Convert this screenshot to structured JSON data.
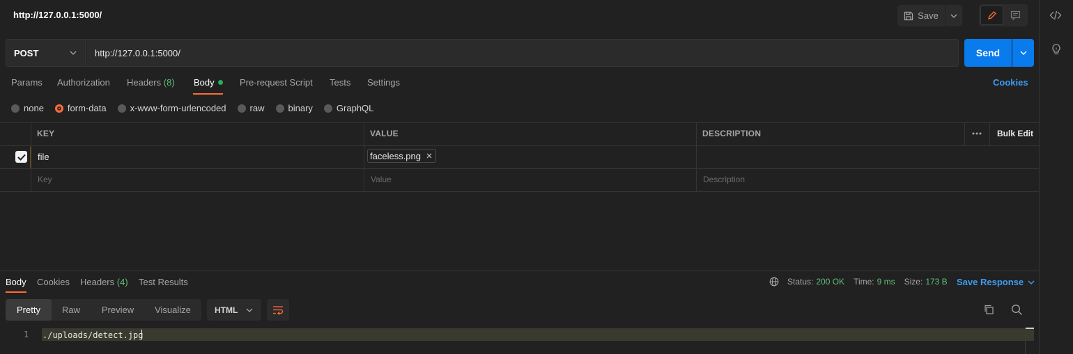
{
  "header": {
    "title": "http://127.0.0.1:5000/",
    "save_label": "Save"
  },
  "request": {
    "method": "POST",
    "url": "http://127.0.0.1:5000/",
    "send_label": "Send",
    "tabs": [
      {
        "label": "Params"
      },
      {
        "label": "Authorization"
      },
      {
        "label": "Headers",
        "count": "(8)"
      },
      {
        "label": "Body"
      },
      {
        "label": "Pre-request Script"
      },
      {
        "label": "Tests"
      },
      {
        "label": "Settings"
      }
    ],
    "cookies_label": "Cookies",
    "body_types": [
      "none",
      "form-data",
      "x-www-form-urlencoded",
      "raw",
      "binary",
      "GraphQL"
    ],
    "selected_body_type": "form-data"
  },
  "params_table": {
    "headers": {
      "key": "KEY",
      "value": "VALUE",
      "description": "DESCRIPTION",
      "bulk_edit": "Bulk Edit"
    },
    "rows": [
      {
        "key": "file",
        "value": "faceless.png",
        "checked": true
      }
    ],
    "placeholders": {
      "key": "Key",
      "value": "Value",
      "description": "Description"
    }
  },
  "response": {
    "tabs": [
      {
        "label": "Body"
      },
      {
        "label": "Cookies"
      },
      {
        "label": "Headers",
        "count": "(4)"
      },
      {
        "label": "Test Results"
      }
    ],
    "status_label": "Status:",
    "status_value": "200 OK",
    "time_label": "Time:",
    "time_value": "9 ms",
    "size_label": "Size:",
    "size_value": "173 B",
    "save_response_label": "Save Response",
    "views": [
      "Pretty",
      "Raw",
      "Preview",
      "Visualize"
    ],
    "format": "HTML",
    "lines": [
      {
        "num": "1",
        "text": "./uploads/detect.jpg"
      }
    ]
  },
  "colors": {
    "accent": "#ff6c37",
    "send": "#097bed",
    "link": "#3d9cf4",
    "success": "#5fbf7a"
  }
}
